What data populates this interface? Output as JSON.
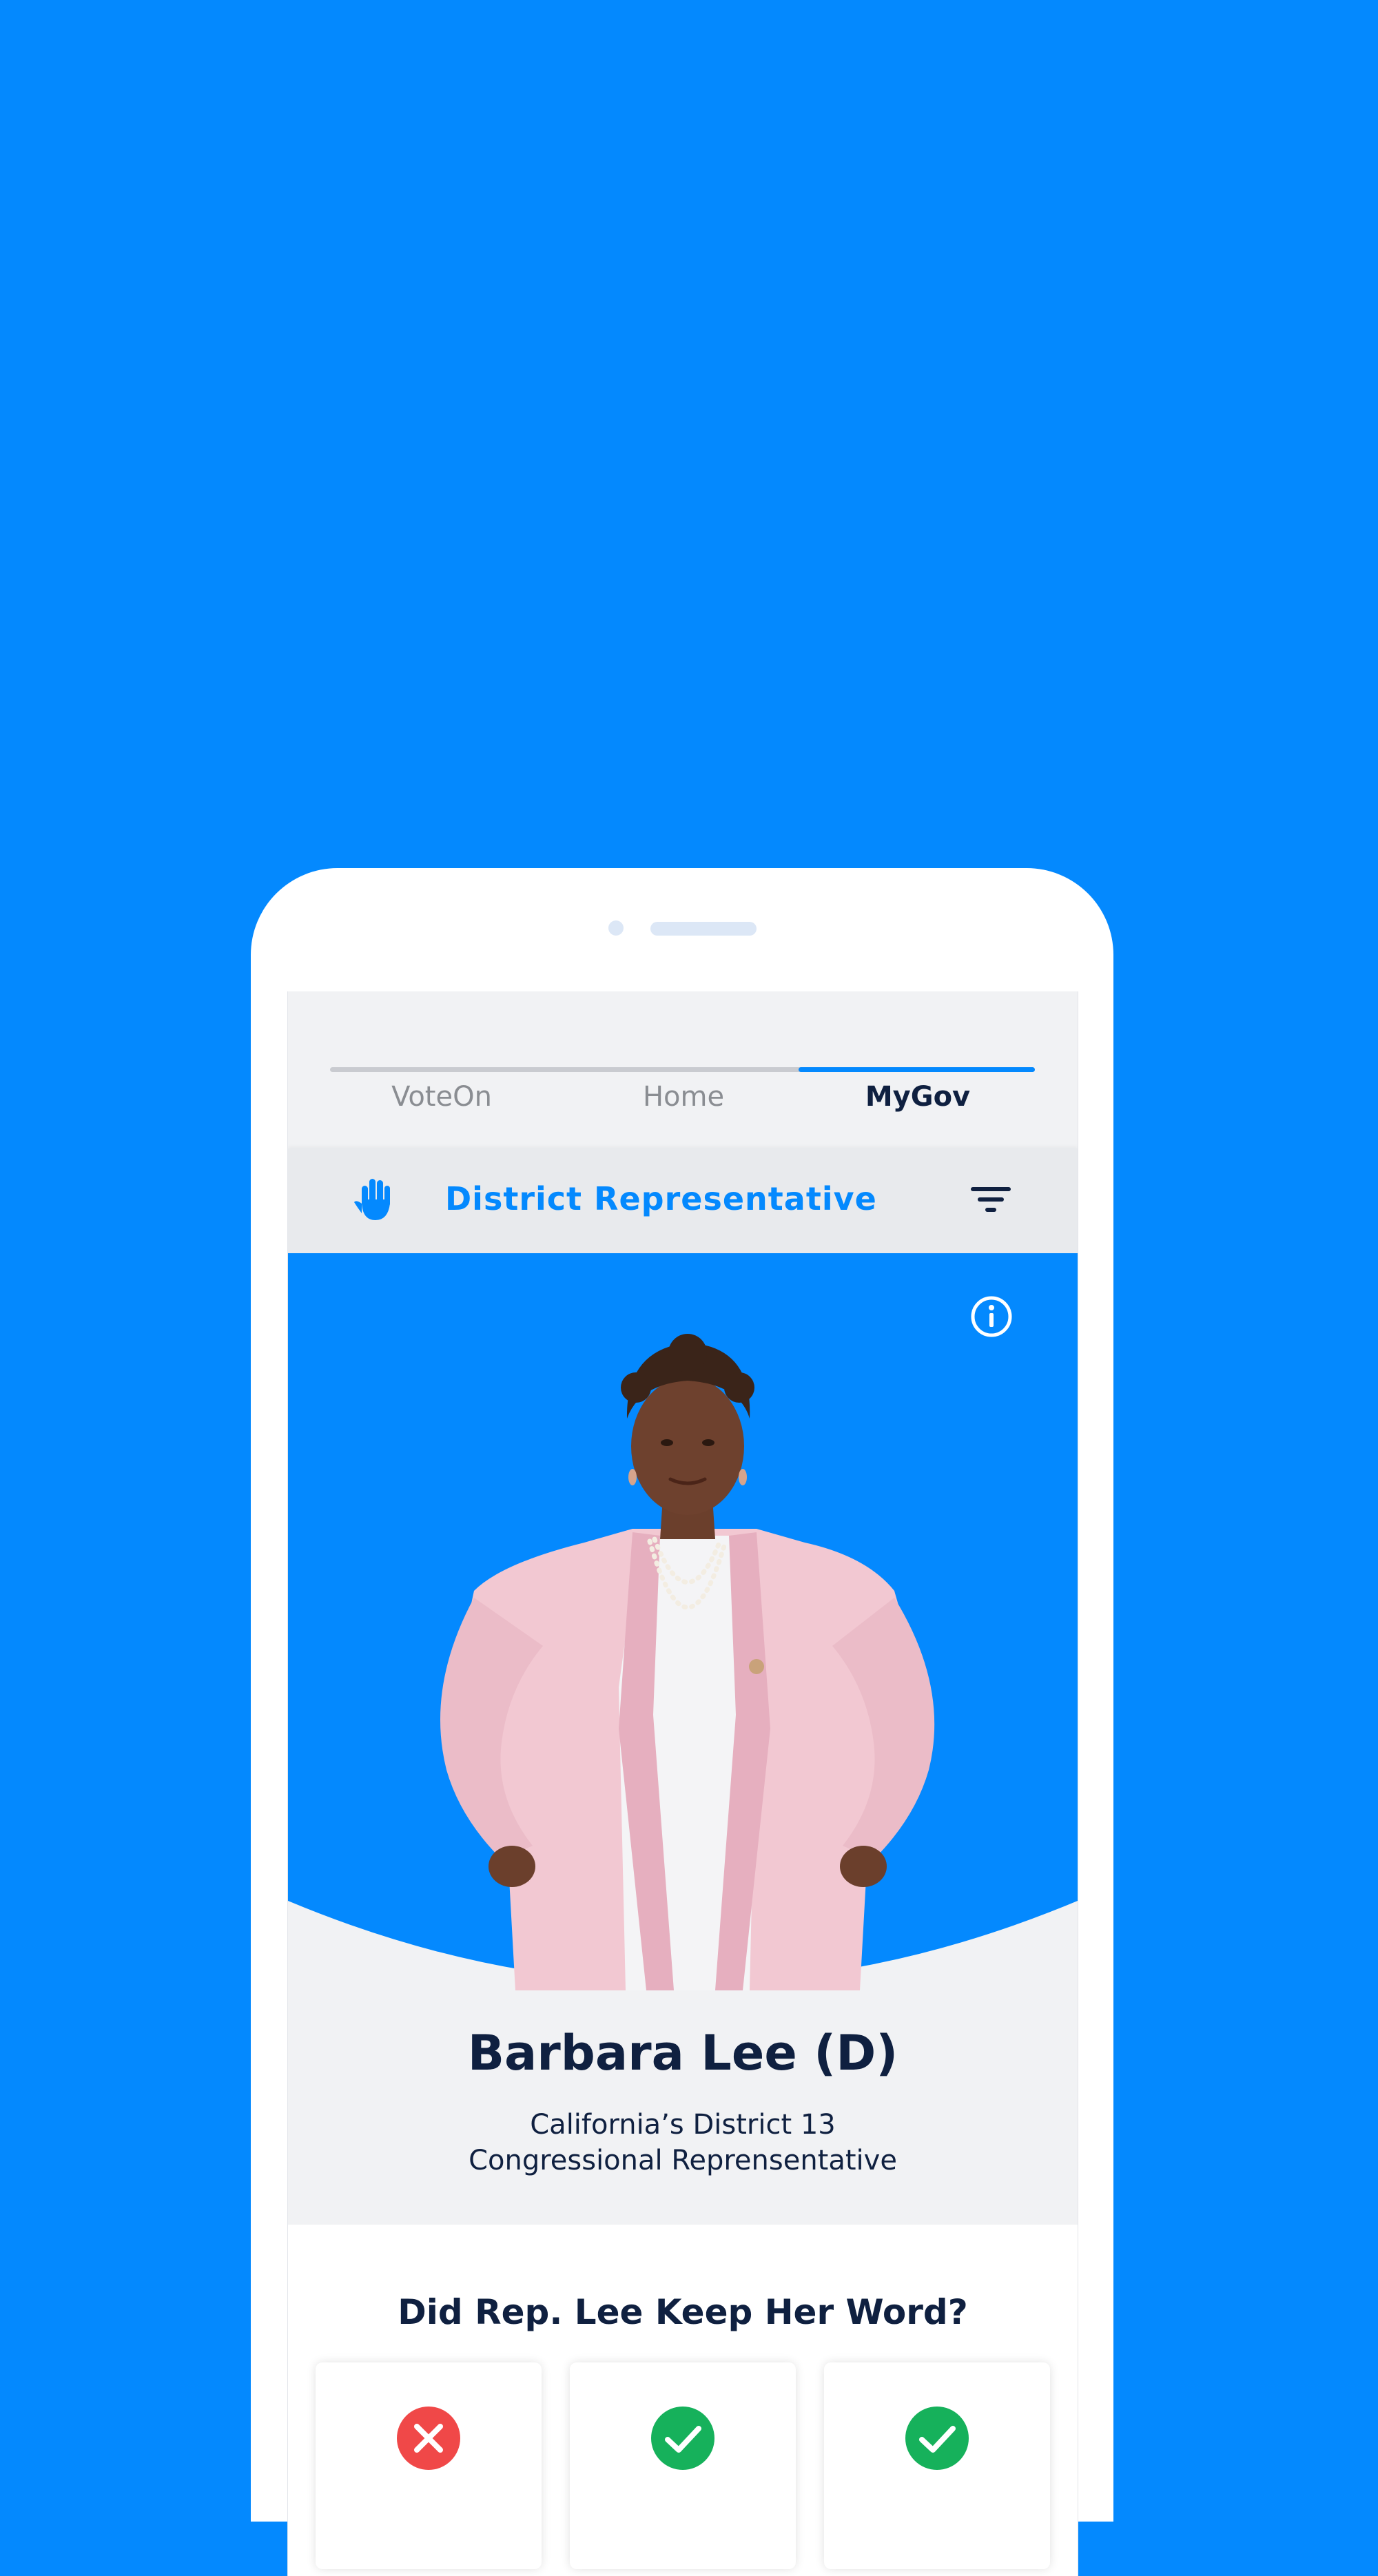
{
  "tabs": [
    {
      "label": "VoteOn",
      "active": false
    },
    {
      "label": "Home",
      "active": false
    },
    {
      "label": "MyGov",
      "active": true
    }
  ],
  "header": {
    "title": "District Representative",
    "left_icon": "raised-hand-icon",
    "right_icon": "filter-icon"
  },
  "hero": {
    "info_icon": "info-icon",
    "photo": "portrait"
  },
  "profile": {
    "name": "Barbara Lee (D)",
    "line1": "California’s District 13",
    "line2": "Congressional Reprensentative"
  },
  "question": {
    "title": "Did Rep. Lee Keep Her Word?",
    "cards": [
      {
        "status": "broken",
        "icon": "x-circle-icon"
      },
      {
        "status": "kept",
        "icon": "check-circle-icon"
      },
      {
        "status": "kept",
        "icon": "check-circle-icon"
      }
    ]
  },
  "colors": {
    "background": "#0489FE",
    "accent": "#0489FE",
    "text_dark": "#0F2040",
    "tab_inactive": "#8A8D92",
    "danger": "#F04848",
    "success": "#16B15B"
  }
}
